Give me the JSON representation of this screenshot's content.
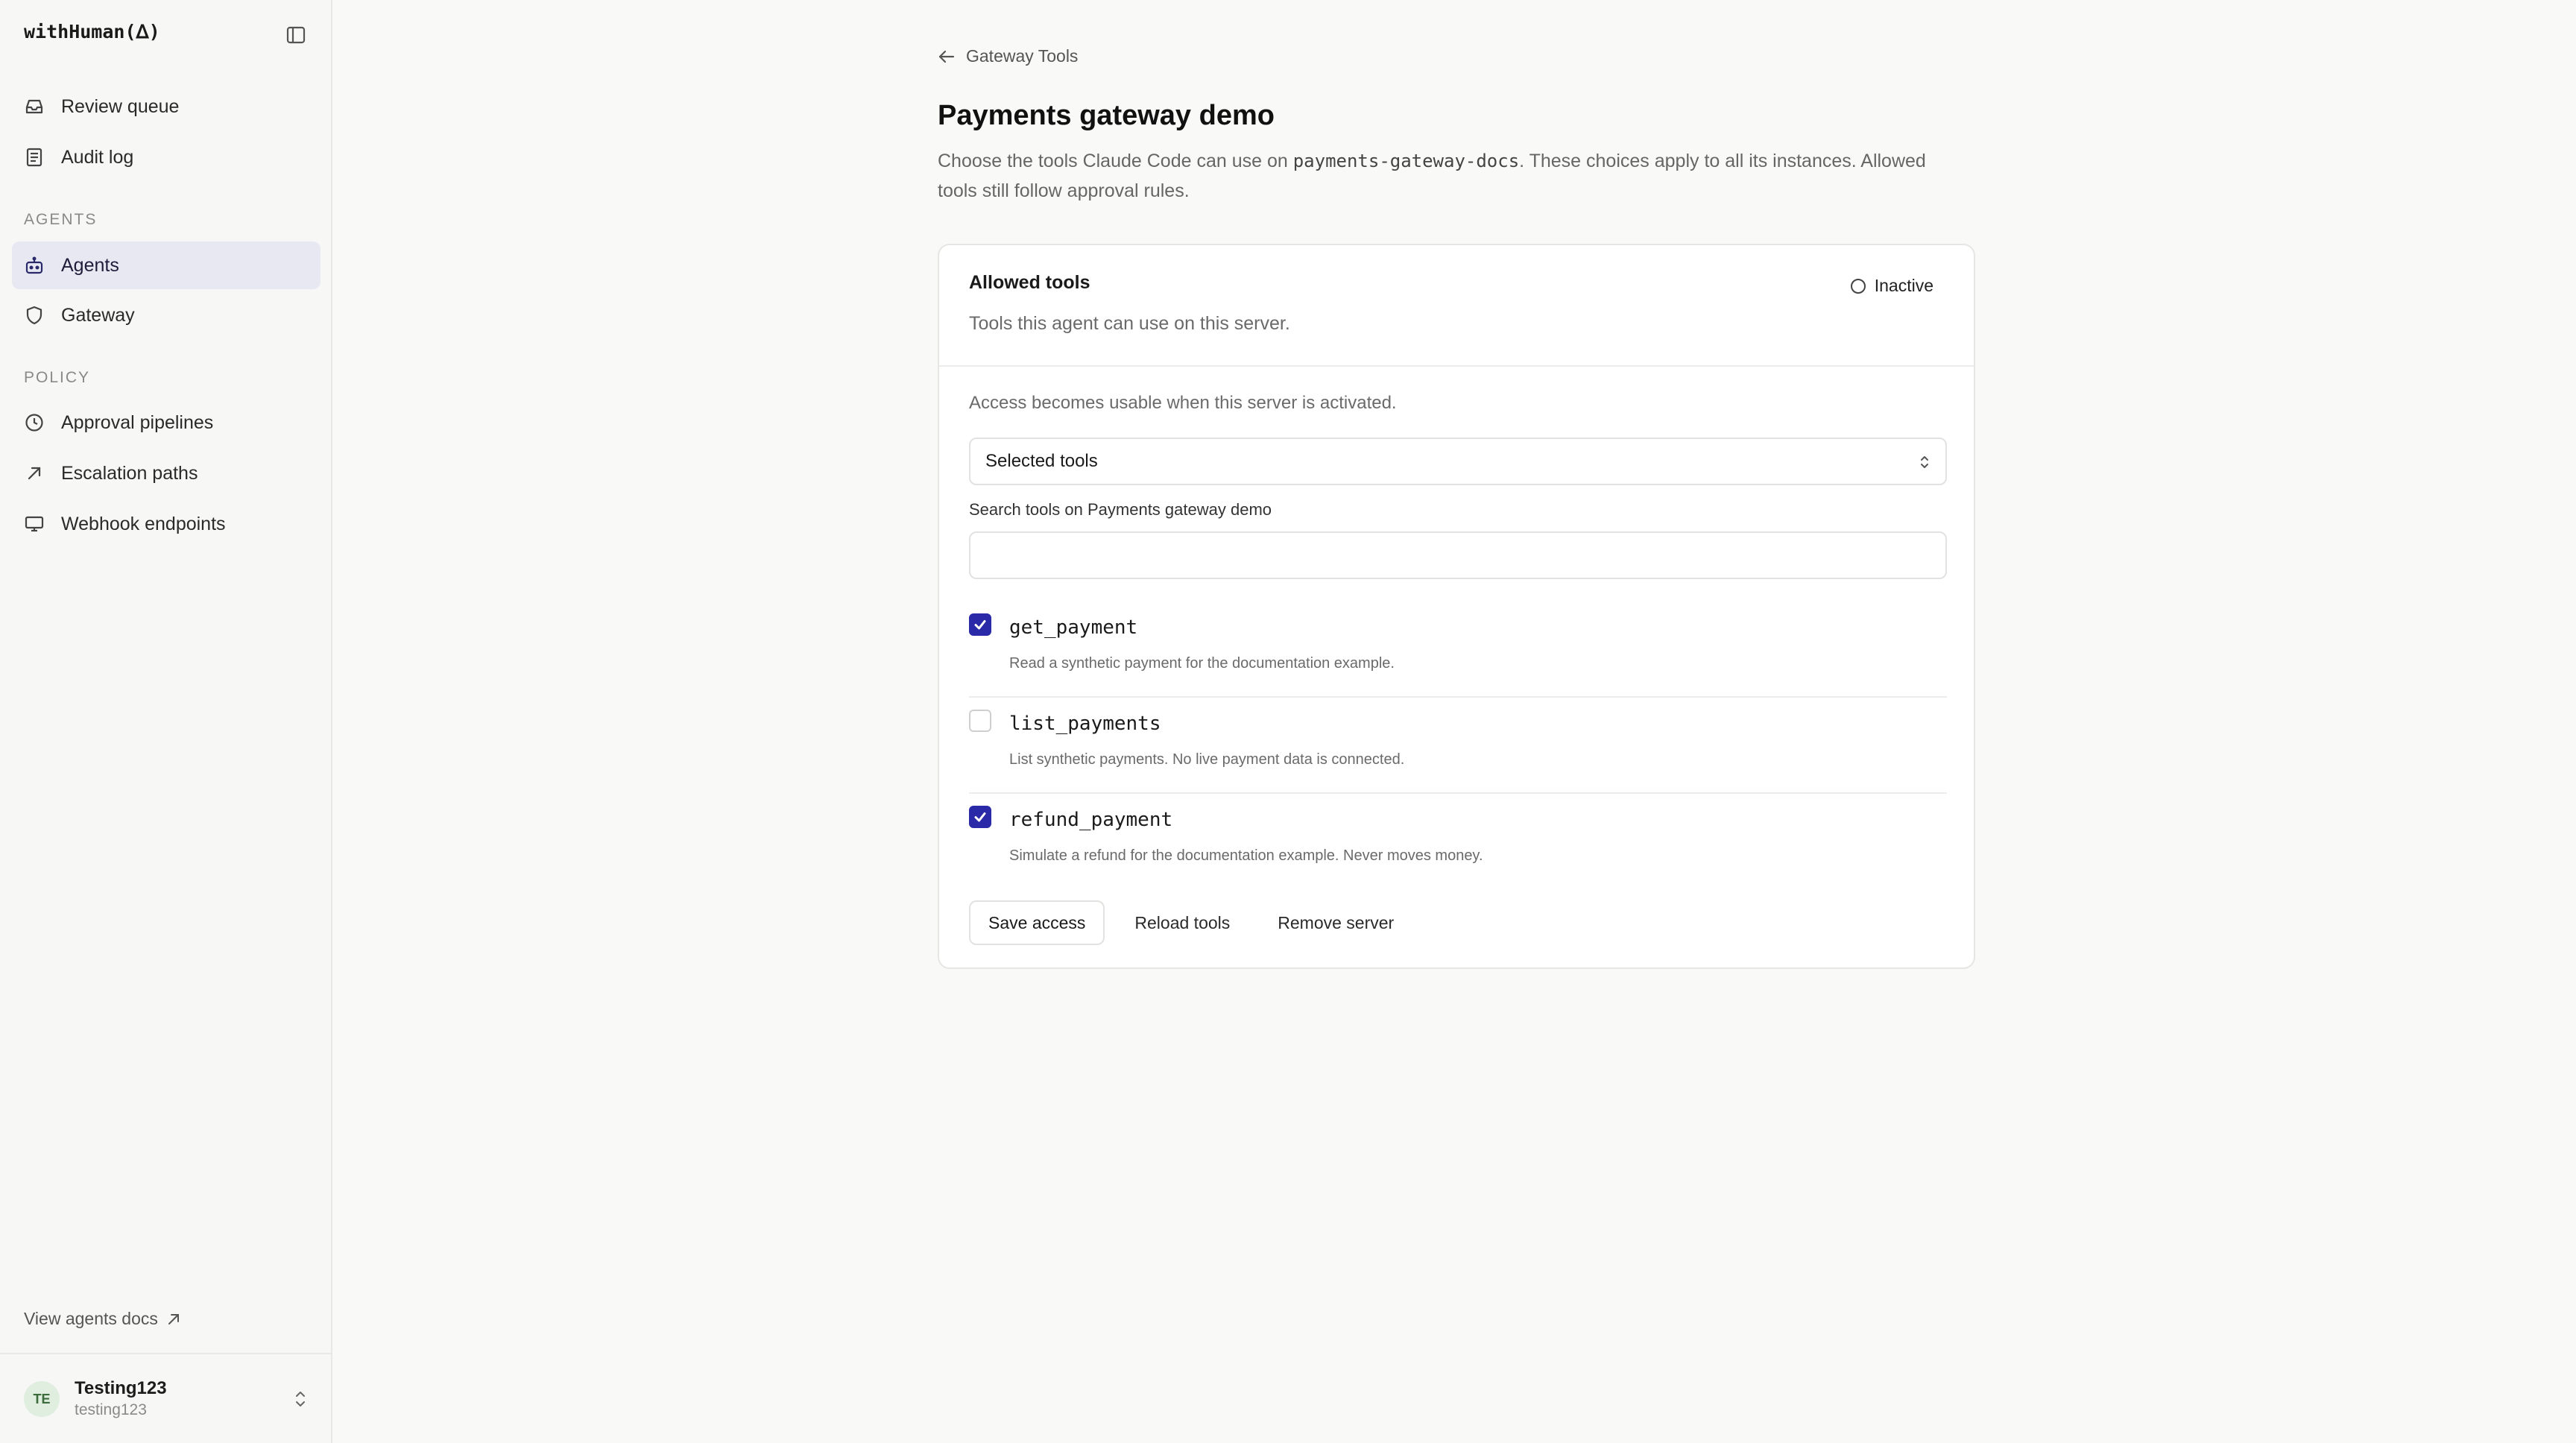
{
  "app": {
    "brand": "withHuman(ᐃ)"
  },
  "sidebar": {
    "top_items": [
      {
        "label": "Review queue",
        "icon": "inbox-icon"
      },
      {
        "label": "Audit log",
        "icon": "document-icon"
      }
    ],
    "sections": [
      {
        "title": "AGENTS",
        "items": [
          {
            "label": "Agents",
            "icon": "bot-icon",
            "active": true
          },
          {
            "label": "Gateway",
            "icon": "shield-icon"
          }
        ]
      },
      {
        "title": "POLICY",
        "items": [
          {
            "label": "Approval pipelines",
            "icon": "clock-icon"
          },
          {
            "label": "Escalation paths",
            "icon": "arrow-up-right-icon"
          },
          {
            "label": "Webhook endpoints",
            "icon": "monitor-icon"
          }
        ]
      }
    ],
    "docs_link": "View agents docs",
    "user": {
      "initials": "TE",
      "name": "Testing123",
      "handle": "testing123"
    }
  },
  "main": {
    "back_link": "Gateway Tools",
    "title": "Payments gateway demo",
    "description": {
      "before": "Choose the tools Claude Code can use on ",
      "code": "payments-gateway-docs",
      "after": ". These choices apply to all its instances. Allowed tools still follow approval rules."
    },
    "card": {
      "title": "Allowed tools",
      "subtitle": "Tools this agent can use on this server.",
      "status": "Inactive",
      "activation_note": "Access becomes usable when this server is activated.",
      "select_value": "Selected tools",
      "search_label": "Search tools on Payments gateway demo",
      "search_value": "",
      "search_placeholder": "",
      "tools": [
        {
          "name": "get_payment",
          "description": "Read a synthetic payment for the documentation example.",
          "checked": true
        },
        {
          "name": "list_payments",
          "description": "List synthetic payments. No live payment data is connected.",
          "checked": false
        },
        {
          "name": "refund_payment",
          "description": "Simulate a refund for the documentation example. Never moves money.",
          "checked": true
        }
      ],
      "actions": {
        "save": "Save access",
        "reload": "Reload tools",
        "remove": "Remove server"
      }
    }
  },
  "colors": {
    "accent": "#2a2aa8",
    "active_nav_bg": "#e8e8f3",
    "avatar_bg": "#dfeede"
  }
}
